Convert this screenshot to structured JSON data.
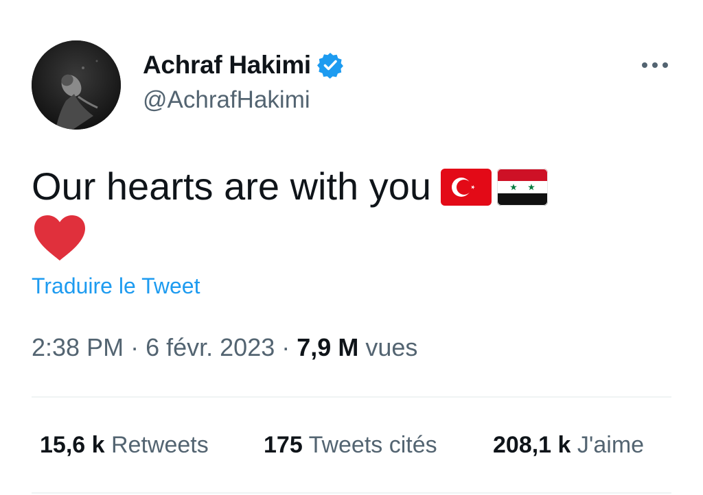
{
  "tweet": {
    "author": {
      "display_name": "Achraf Hakimi",
      "handle": "@AchrafHakimi",
      "verified": true,
      "avatar_icon": "profile-photo"
    },
    "more_icon": "ellipsis-icon",
    "text": "Our hearts are with you",
    "emojis": [
      "flag-turkey",
      "flag-syria",
      "red-heart"
    ],
    "translate_label": "Traduire le Tweet",
    "time": "2:38 PM",
    "separator": "·",
    "date": "6 févr. 2023",
    "views_count": "7,9 M",
    "views_label": "vues",
    "stats": {
      "retweets": {
        "count": "15,6 k",
        "label": "Retweets"
      },
      "quotes": {
        "count": "175",
        "label": "Tweets cités"
      },
      "likes": {
        "count": "208,1 k",
        "label": "J'aime"
      }
    }
  },
  "colors": {
    "text_primary": "#0f1419",
    "text_secondary": "#536471",
    "link": "#1d9bf0",
    "verified_badge": "#1d9bf0",
    "divider": "#eff3f4",
    "heart": "#e0303c",
    "turkey_red": "#e30a17",
    "syria_red": "#ce1126",
    "syria_green": "#007a3d"
  }
}
